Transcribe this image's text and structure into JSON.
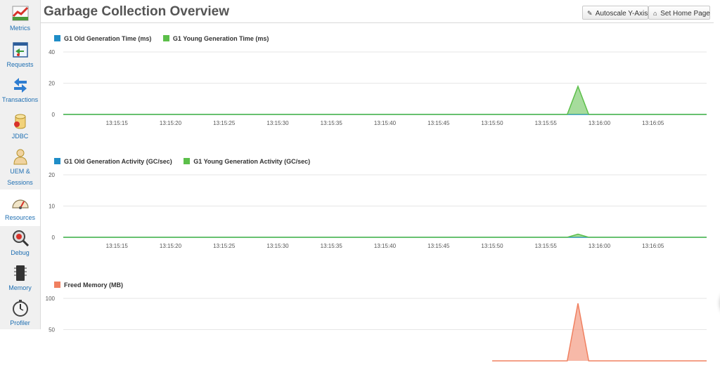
{
  "page": {
    "title": "Garbage Collection Overview"
  },
  "toolbar": {
    "autoscale_label": "Autoscale Y-Axis",
    "autoscale_icon": "wrench-icon",
    "home_label": "Set Home Page",
    "home_icon": "home-icon"
  },
  "sidebar": {
    "items": [
      {
        "label": "Metrics",
        "icon": "chart-icon"
      },
      {
        "label": "Requests",
        "icon": "requests-icon"
      },
      {
        "label": "Transactions",
        "icon": "transactions-icon"
      },
      {
        "label": "JDBC",
        "icon": "database-icon"
      },
      {
        "label": "UEM &",
        "label2": "Sessions",
        "icon": "user-icon"
      },
      {
        "label": "Resources",
        "icon": "gauge-icon",
        "active": true
      },
      {
        "label": "Debug",
        "icon": "debug-icon"
      },
      {
        "label": "Memory",
        "icon": "memory-icon"
      },
      {
        "label": "Profiler",
        "icon": "stopwatch-icon"
      }
    ]
  },
  "colors": {
    "blue": "#1f8dc7",
    "green": "#5cbf4a",
    "orange": "#f08060",
    "link": "#1f6fb2",
    "chat": "#1e88e5"
  },
  "chart_data": [
    {
      "type": "area",
      "title": "",
      "legend_placement": "top-left",
      "grid": true,
      "x": [
        "13:15:15",
        "13:15:20",
        "13:15:25",
        "13:15:30",
        "13:15:35",
        "13:15:40",
        "13:15:45",
        "13:15:50",
        "13:15:55",
        "13:16:00",
        "13:16:05"
      ],
      "x_range": [
        "13:15:10",
        "13:16:10"
      ],
      "ylim": [
        0,
        40
      ],
      "yticks": [
        0,
        20,
        40
      ],
      "series": [
        {
          "name": "G1 Old Generation Time (ms)",
          "color": "#1f8dc7",
          "points": [
            [
              "13:15:10",
              0
            ],
            [
              "13:16:10",
              0
            ]
          ]
        },
        {
          "name": "G1 Young Generation Time (ms)",
          "color": "#5cbf4a",
          "points": [
            [
              "13:15:10",
              0
            ],
            [
              "13:15:57",
              0
            ],
            [
              "13:15:58",
              18
            ],
            [
              "13:15:59",
              0
            ],
            [
              "13:16:10",
              0
            ]
          ]
        }
      ]
    },
    {
      "type": "area",
      "title": "",
      "legend_placement": "top-left",
      "grid": true,
      "x": [
        "13:15:15",
        "13:15:20",
        "13:15:25",
        "13:15:30",
        "13:15:35",
        "13:15:40",
        "13:15:45",
        "13:15:50",
        "13:15:55",
        "13:16:00",
        "13:16:05"
      ],
      "x_range": [
        "13:15:10",
        "13:16:10"
      ],
      "ylim": [
        0,
        20
      ],
      "yticks": [
        0,
        10,
        20
      ],
      "series": [
        {
          "name": "G1 Old Generation Activity (GC/sec)",
          "color": "#1f8dc7",
          "points": [
            [
              "13:15:10",
              0
            ],
            [
              "13:16:10",
              0
            ]
          ]
        },
        {
          "name": "G1 Young Generation Activity (GC/sec)",
          "color": "#5cbf4a",
          "points": [
            [
              "13:15:10",
              0
            ],
            [
              "13:15:57",
              0
            ],
            [
              "13:15:58",
              1
            ],
            [
              "13:15:59",
              0
            ],
            [
              "13:16:10",
              0
            ]
          ]
        }
      ]
    },
    {
      "type": "area",
      "title": "",
      "legend_placement": "top-left",
      "grid": true,
      "x": [],
      "x_range": [
        "13:15:10",
        "13:16:10"
      ],
      "ylim": [
        0,
        100
      ],
      "yticks": [
        50,
        100
      ],
      "series": [
        {
          "name": "Freed Memory (MB)",
          "color": "#f08060",
          "points": [
            [
              "13:15:50",
              0
            ],
            [
              "13:15:57",
              0
            ],
            [
              "13:15:58",
              92
            ],
            [
              "13:15:59",
              0
            ],
            [
              "13:16:10",
              0
            ]
          ]
        }
      ]
    }
  ]
}
